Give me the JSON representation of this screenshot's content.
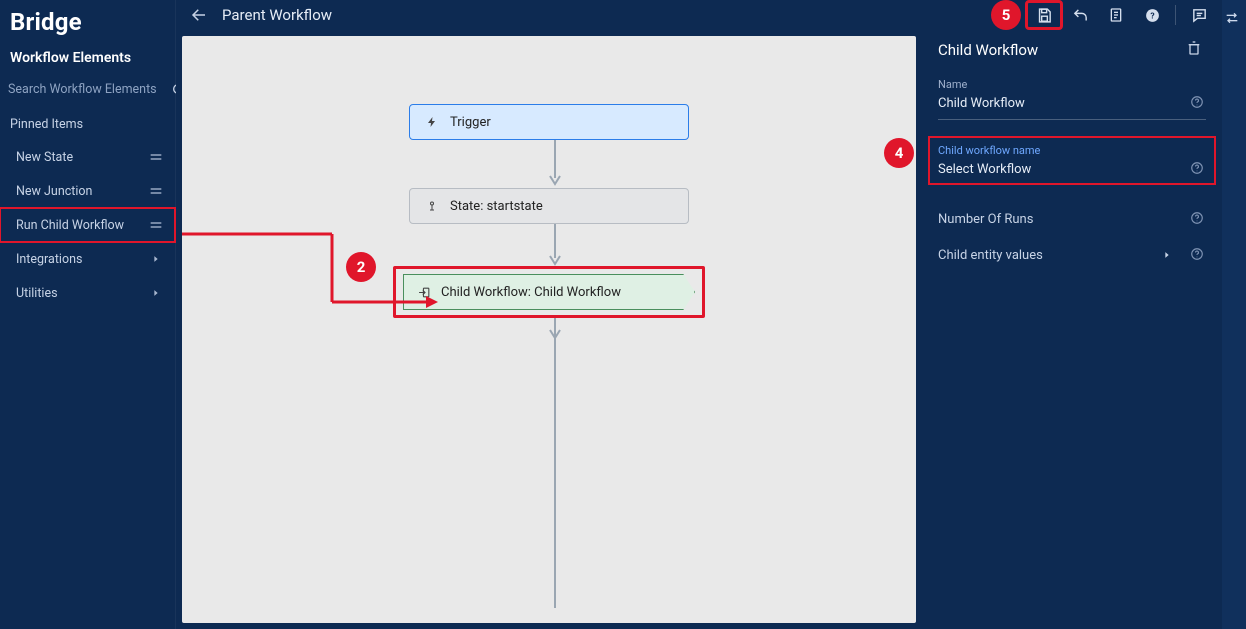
{
  "brand": "Bridge",
  "sidebar": {
    "heading": "Workflow Elements",
    "search_placeholder": "Search Workflow Elements",
    "pinned_label": "Pinned Items",
    "items": [
      {
        "label": "New State"
      },
      {
        "label": "New Junction"
      },
      {
        "label": "Run Child Workflow"
      }
    ],
    "groups": [
      {
        "label": "Integrations"
      },
      {
        "label": "Utilities"
      }
    ]
  },
  "header": {
    "title": "Parent Workflow"
  },
  "toolbar": {
    "save": "Save",
    "undo": "Undo",
    "notes": "Notes",
    "help": "Help",
    "comments": "Comments"
  },
  "canvas": {
    "trigger_label": "Trigger",
    "state_label": "State: startstate",
    "child_label": "Child Workflow: Child Workflow"
  },
  "right": {
    "title": "Child Workflow",
    "name_label": "Name",
    "name_value": "Child Workflow",
    "childwf_label": "Child workflow name",
    "childwf_value": "Select Workflow",
    "runs_label": "Number Of Runs",
    "entity_label": "Child entity values"
  },
  "annotations": {
    "b2": "2",
    "b4": "4",
    "b5": "5"
  }
}
